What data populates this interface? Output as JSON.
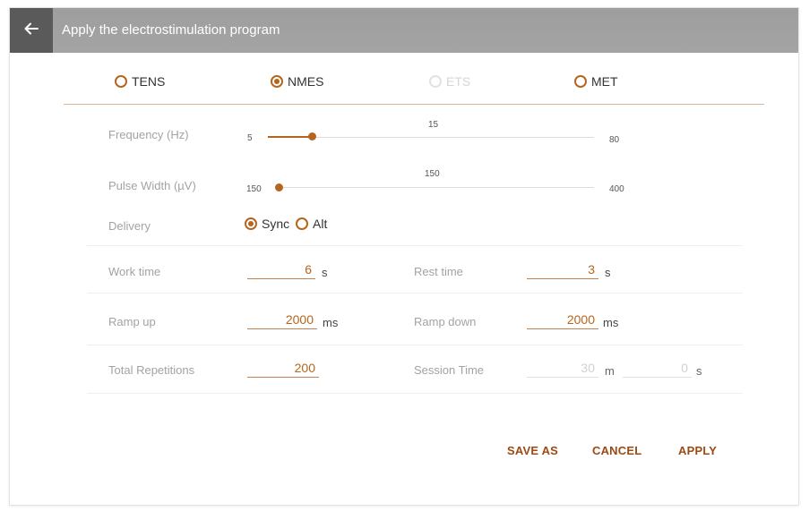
{
  "header": {
    "title": "Apply the electrostimulation program",
    "back_icon": "arrow-left-icon"
  },
  "modes": [
    {
      "label": "TENS",
      "selected": false,
      "disabled": false
    },
    {
      "label": "NMES",
      "selected": true,
      "disabled": false
    },
    {
      "label": "ETS",
      "selected": false,
      "disabled": true
    },
    {
      "label": "MET",
      "selected": false,
      "disabled": false
    }
  ],
  "frequency": {
    "label": "Frequency (Hz)",
    "min": "5",
    "max": "80",
    "value": "15",
    "level": 0.135
  },
  "pulse_width": {
    "label": "Pulse Width (µV)",
    "min": "150",
    "max": "400",
    "value": "150",
    "level": 0.0
  },
  "delivery": {
    "label": "Delivery",
    "options": [
      "Sync",
      "Alt"
    ],
    "selected": "Sync"
  },
  "work_time": {
    "label": "Work time",
    "value": "6",
    "unit": "s"
  },
  "rest_time": {
    "label": "Rest time",
    "value": "3",
    "unit": "s"
  },
  "ramp_up": {
    "label": "Ramp up",
    "value": "2000",
    "unit": "ms"
  },
  "ramp_down": {
    "label": "Ramp down",
    "value": "2000",
    "unit": "ms"
  },
  "total_repetitions": {
    "label": "Total Repetitions",
    "value": "200"
  },
  "session_time": {
    "label": "Session Time",
    "minutes": "30",
    "minutes_unit": "m",
    "seconds": "0",
    "seconds_unit": "s"
  },
  "actions": {
    "save_as": "SAVE AS",
    "cancel": "CANCEL",
    "apply": "APPLY"
  },
  "colors": {
    "accent": "#b5651d",
    "titlebar": "#a2a2a2",
    "back_button": "#5a5a5a"
  }
}
